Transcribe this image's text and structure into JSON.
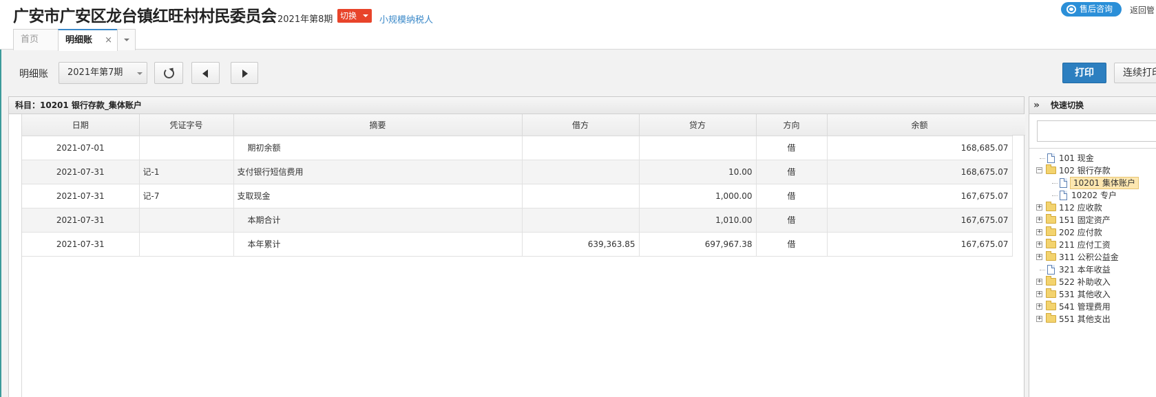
{
  "header": {
    "company": "广安市广安区龙台镇红旺村村民委员会",
    "period": "2021年第8期",
    "switch_label": "切换",
    "taxpayer": "小规模纳税人",
    "consult_label": "售后咨询",
    "back_label": "返回管"
  },
  "tabs": [
    {
      "label": "首页"
    },
    {
      "label": "明细账",
      "close": "×"
    }
  ],
  "toolbar": {
    "label": "明细账",
    "period_select": "2021年第7期",
    "print_label": "打印",
    "continuous_print_label": "连续打印"
  },
  "panel": {
    "title": "科目：10201  银行存款_集体账户",
    "columns": [
      "日期",
      "凭证字号",
      "摘要",
      "借方",
      "贷方",
      "方向",
      "余额"
    ],
    "rows": [
      {
        "date": "2021-07-01",
        "voucher": "",
        "summary": "期初余额",
        "debit": "",
        "credit": "",
        "direction": "借",
        "balance": "168,685.07",
        "indent": true
      },
      {
        "date": "2021-07-31",
        "voucher": "记-1",
        "summary": "支付银行短信费用",
        "debit": "",
        "credit": "10.00",
        "direction": "借",
        "balance": "168,675.07",
        "indent": false
      },
      {
        "date": "2021-07-31",
        "voucher": "记-7",
        "summary": "支取现金",
        "debit": "",
        "credit": "1,000.00",
        "direction": "借",
        "balance": "167,675.07",
        "indent": false
      },
      {
        "date": "2021-07-31",
        "voucher": "",
        "summary": "本期合计",
        "debit": "",
        "credit": "1,010.00",
        "direction": "借",
        "balance": "167,675.07",
        "indent": true
      },
      {
        "date": "2021-07-31",
        "voucher": "",
        "summary": "本年累计",
        "debit": "639,363.85",
        "credit": "697,967.38",
        "direction": "借",
        "balance": "167,675.07",
        "indent": true
      }
    ]
  },
  "quick_switch": {
    "collapse_glyph": "»",
    "title": "快速切换",
    "tree": [
      {
        "label": "101 现金",
        "icon": "file-icon",
        "level": 0,
        "expander": ""
      },
      {
        "label": "102 银行存款",
        "icon": "folder-icon",
        "level": 0,
        "expander": "−"
      },
      {
        "label": "10201 集体账户",
        "icon": "file-icon",
        "level": 1,
        "expander": "",
        "selected": true
      },
      {
        "label": "10202 专户",
        "icon": "file-icon",
        "level": 1,
        "expander": ""
      },
      {
        "label": "112 应收款",
        "icon": "folder-icon",
        "level": 0,
        "expander": "+"
      },
      {
        "label": "151 固定资产",
        "icon": "folder-icon",
        "level": 0,
        "expander": "+"
      },
      {
        "label": "202 应付款",
        "icon": "folder-icon",
        "level": 0,
        "expander": "+"
      },
      {
        "label": "211 应付工资",
        "icon": "folder-icon",
        "level": 0,
        "expander": "+"
      },
      {
        "label": "311 公积公益金",
        "icon": "folder-icon",
        "level": 0,
        "expander": "+"
      },
      {
        "label": "321 本年收益",
        "icon": "file-icon",
        "level": 0,
        "expander": ""
      },
      {
        "label": "522 补助收入",
        "icon": "folder-icon",
        "level": 0,
        "expander": "+"
      },
      {
        "label": "531 其他收入",
        "icon": "folder-icon",
        "level": 0,
        "expander": "+"
      },
      {
        "label": "541 管理费用",
        "icon": "folder-icon",
        "level": 0,
        "expander": "+"
      },
      {
        "label": "551 其他支出",
        "icon": "folder-icon",
        "level": 0,
        "expander": "+"
      }
    ]
  },
  "colors": {
    "accent_blue": "#2d7fc0",
    "switch_red": "#e8442a",
    "selected_node": "#fde7b0"
  }
}
